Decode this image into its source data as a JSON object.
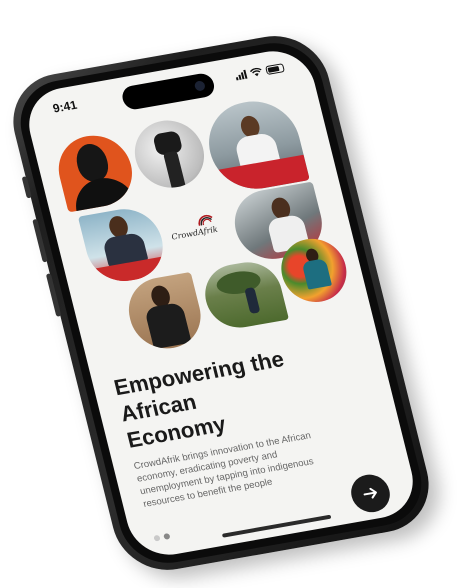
{
  "status_bar": {
    "time": "9:41"
  },
  "brand": {
    "logo_text": "CrowdAfrik"
  },
  "onboarding": {
    "heading_lines": [
      "Empowering the",
      "African",
      "Economy"
    ],
    "description": "CrowdAfrik brings innovation to the African economy, eradicating poverty and unemployment by tapping into indigenous resources to benefit the people",
    "page_count": 2,
    "current_page": 2
  },
  "icons": {
    "next": "arrow-right-icon",
    "signal": "cellular-signal-icon",
    "wifi": "wifi-icon",
    "battery": "battery-icon"
  },
  "colors": {
    "screen_bg": "#f4f4f2",
    "text_primary": "#1a1a1a",
    "text_secondary": "#666666",
    "button_bg": "#1b1b1b",
    "accent_orange": "#e0541d",
    "accent_red": "#d42a2a"
  }
}
